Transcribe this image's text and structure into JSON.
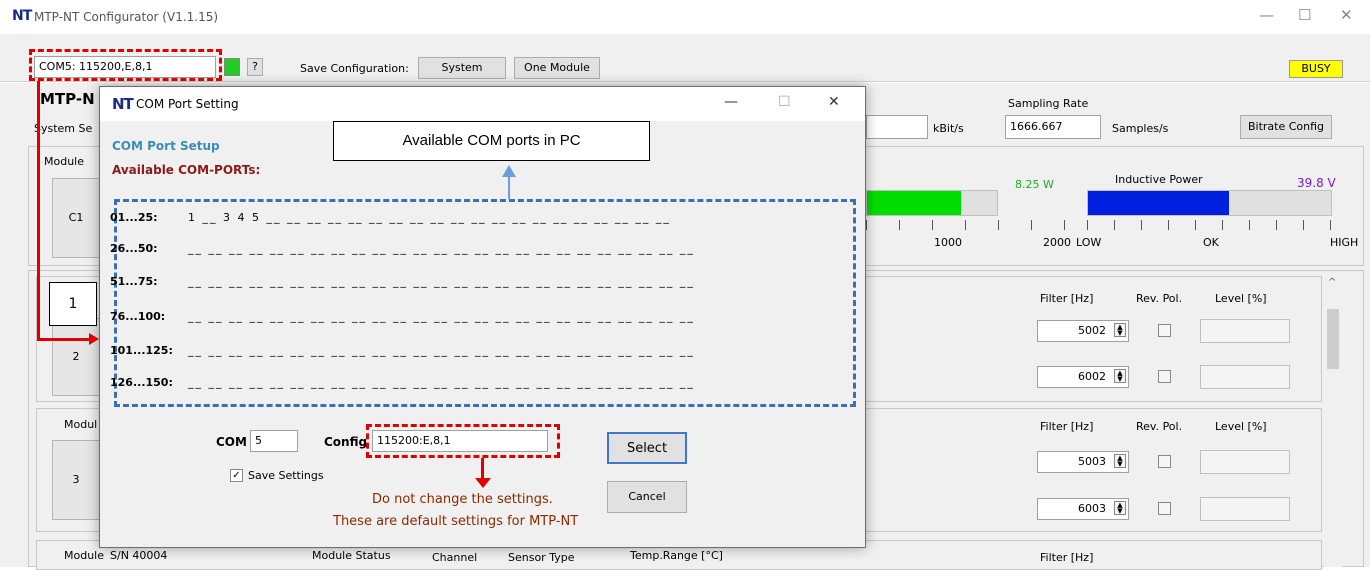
{
  "window": {
    "logo": "NT",
    "title": "MTP-NT Configurator (V1.1.15)",
    "minimize": "—",
    "maximize": "☐",
    "close": "✕"
  },
  "toolbar": {
    "com_field": "COM5: 115200,E,8,1",
    "help_button": "?",
    "save_config_label": "Save Configuration:",
    "system_button": "System",
    "one_module_button": "One Module",
    "busy_badge": "BUSY",
    "status_color": "#22cc22",
    "busy_color": "#ffff00"
  },
  "header": {
    "app_name": "MTP-N",
    "system_settings": "System Se",
    "kbits_unit": "kBit/s",
    "sampling_rate_label": "Sampling Rate",
    "sampling_rate_value": "1666.667",
    "samples_unit": "Samples/s",
    "bitrate_button": "Bitrate Config"
  },
  "power": {
    "module_label": "Module",
    "c1_button": "C1",
    "watts_value": "8.25 W",
    "watts_fill": 0.72,
    "inductive_label": "Inductive Power",
    "volts_value": "39.8  V",
    "inductive_fill": 0.58,
    "scale_1000": "1000",
    "scale_2000": "2000",
    "scale_low": "LOW",
    "scale_ok": "OK",
    "scale_high": "HIGH"
  },
  "modules": {
    "filter_label": "Filter [Hz]",
    "rev_pol_label": "Rev. Pol.",
    "level_label": "Level [%]",
    "m2_button": "2",
    "m2_filter_a": "5002",
    "m2_filter_b": "6002",
    "m3_label": "Modul",
    "m3_button": "3",
    "m3_filter_a": "5003",
    "m3_filter_b": "6003",
    "m4_label": "Module",
    "m4_sn": "S/N 40004",
    "m4_status": "Module Status",
    "m4_channel": "Channel",
    "m4_sensor": "Sensor Type",
    "m4_temp": "Temp.Range  [°C]",
    "m4_filter": "Filter [Hz]"
  },
  "dialog": {
    "logo": "NT",
    "title": "COM Port Setting",
    "minimize": "—",
    "maximize": "☐",
    "close": "✕",
    "heading": "COM Port Setup",
    "subheading": "Available COM-PORTs:",
    "rows": [
      {
        "label": "01...25:",
        "slots": "1   __  3   4   5   __  __  __  __  __  __  __  __  __  __  __  __  __  __  __  __  __  __  __  __"
      },
      {
        "label": "26...50:",
        "slots": "__  __  __  __  __  __  __  __  __  __  __  __  __  __  __  __  __  __  __  __  __  __  __  __  __"
      },
      {
        "label": "51...75:",
        "slots": "__  __  __  __  __  __  __  __  __  __  __  __  __  __  __  __  __  __  __  __  __  __  __  __  __"
      },
      {
        "label": "76...100:",
        "slots": "__  __  __  __  __  __  __  __  __  __  __  __  __  __  __  __  __  __  __  __  __  __  __  __  __"
      },
      {
        "label": "101...125:",
        "slots": "__  __  __  __  __  __  __  __  __  __  __  __  __  __  __  __  __  __  __  __  __  __  __  __  __"
      },
      {
        "label": "126...150:",
        "slots": "__  __  __  __  __  __  __  __  __  __  __  __  __  __  __  __  __  __  __  __  __  __  __  __  __"
      }
    ],
    "com_label": "COM",
    "com_value": "5",
    "config_label": "Config",
    "config_value": "115200:E,8,1",
    "save_settings": "Save Settings",
    "select_button": "Select",
    "cancel_button": "Cancel"
  },
  "annotations": {
    "callout_ports": "Available COM ports in PC",
    "marker_1": "1",
    "note_line1": "Do not change the settings.",
    "note_line2": "These are default settings for MTP-NT",
    "red": "#e00000",
    "blue": "#3a6fb0"
  }
}
